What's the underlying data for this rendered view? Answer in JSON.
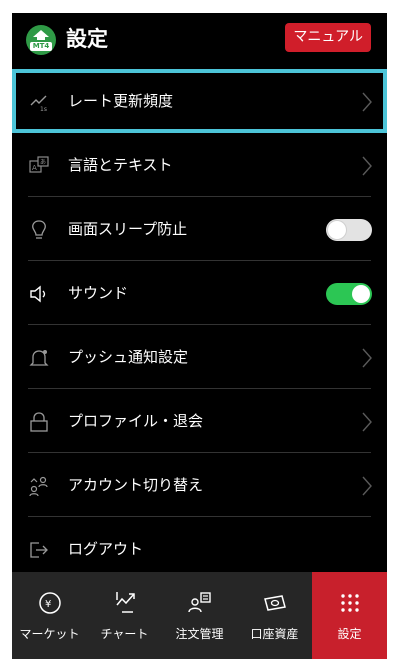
{
  "header": {
    "logo_text": "MT4",
    "title": "設定",
    "manual_button": "マニュアル"
  },
  "settings": {
    "items": [
      {
        "label": "レート更新頻度",
        "icon": "rate-refresh-icon",
        "control": "chevron",
        "selected": true
      },
      {
        "label": "言語とテキスト",
        "icon": "language-icon",
        "control": "chevron"
      },
      {
        "label": "画面スリープ防止",
        "icon": "lightbulb-icon",
        "control": "toggle",
        "toggle_on": false
      },
      {
        "label": "サウンド",
        "icon": "speaker-icon",
        "control": "toggle",
        "toggle_on": true
      },
      {
        "label": "プッシュ通知設定",
        "icon": "bell-icon",
        "control": "chevron"
      },
      {
        "label": "プロファイル・退会",
        "icon": "profile-icon",
        "control": "chevron"
      },
      {
        "label": "アカウント切り替え",
        "icon": "switch-account-icon",
        "control": "chevron"
      },
      {
        "label": "ログアウト",
        "icon": "logout-icon",
        "control": "none"
      }
    ]
  },
  "tabbar": {
    "items": [
      {
        "label": "マーケット",
        "icon": "market-icon"
      },
      {
        "label": "チャート",
        "icon": "chart-icon"
      },
      {
        "label": "注文管理",
        "icon": "order-management-icon"
      },
      {
        "label": "口座資産",
        "icon": "account-assets-icon"
      },
      {
        "label": "設定",
        "icon": "settings-grid-icon",
        "active": true
      }
    ]
  },
  "colors": {
    "background": "#000000",
    "accent_red": "#d01e2a",
    "selected_outline": "#4cc4d8",
    "toggle_on": "#2cc654",
    "toggle_off": "#e3e3e3",
    "tabbar_bg": "#262626"
  }
}
